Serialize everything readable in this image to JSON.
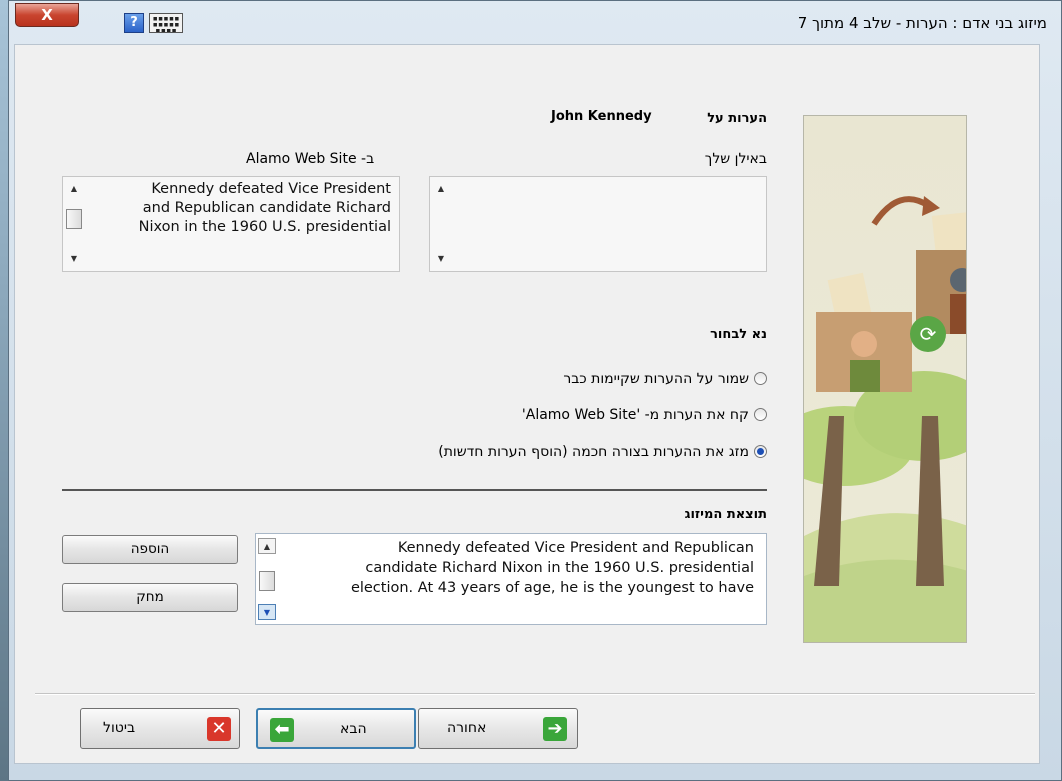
{
  "window": {
    "title": "מיזוג בני אדם : הערות -  שלב 4 מתוך 7",
    "close_label": "X",
    "help_label": "?"
  },
  "header": {
    "notes_on_label": "הערות על",
    "person_name": "John Kennedy"
  },
  "sources": {
    "your_tree_label": "באילן שלך",
    "your_tree_text": "",
    "other_label": "ב- Alamo Web Site",
    "other_text_lines": [
      "Kennedy defeated Vice President",
      "and Republican candidate Richard",
      "Nixon in the 1960 U.S. presidential"
    ]
  },
  "choice": {
    "heading": "נא לבחור",
    "options": [
      {
        "label": "שמור על ההערות שקיימות כבר",
        "selected": false
      },
      {
        "label": "קח את הערות מ-  'Alamo Web Site'",
        "selected": false
      },
      {
        "label": "מזג את ההערות בצורה חכמה (הוסף הערות חדשות)",
        "selected": true
      }
    ]
  },
  "result": {
    "heading": "תוצאת המיזוג",
    "text_lines": [
      "Kennedy defeated Vice President and Republican",
      "candidate Richard Nixon in the 1960 U.S. presidential",
      "election. At 43 years of age, he is the youngest to have"
    ],
    "add_button": "הוספה",
    "delete_button": "מחק"
  },
  "footer": {
    "back_button": "אחורה",
    "next_button": "הבא",
    "cancel_button": "ביטול"
  },
  "icons": {
    "back": "arrow-right-icon",
    "next": "arrow-left-icon",
    "cancel": "x-icon"
  },
  "colors": {
    "green_arrow": "#3aa63a",
    "cancel_red": "#d9372b",
    "radio_selected": "#1d4fb5"
  }
}
